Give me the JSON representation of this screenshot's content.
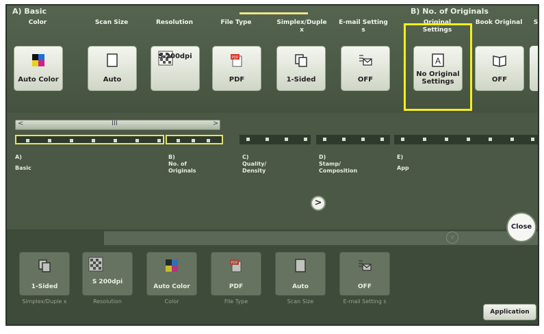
{
  "group_basic": "A)  Basic",
  "group_originals": "B)  No. of Originals",
  "notch_label": "III",
  "headers": [
    "Color",
    "Scan Size",
    "Resolution",
    "File Type",
    "Simplex/Duple x",
    "E-mail Setting s",
    "Original Settings",
    "Book Original",
    "S"
  ],
  "buttons": [
    {
      "value": "Auto Color",
      "icon": "color-icon"
    },
    {
      "value": "Auto",
      "icon": "page-icon"
    },
    {
      "value": "S 200dpi",
      "icon": "resolution-icon"
    },
    {
      "value": "PDF",
      "icon": "pdf-icon"
    },
    {
      "value": "1-Sided",
      "icon": "simplex-icon"
    },
    {
      "value": "OFF",
      "icon": "email-icon"
    },
    {
      "value": "No Original Settings",
      "icon": "original-icon"
    },
    {
      "value": "OFF",
      "icon": "book-icon"
    }
  ],
  "scroll_left": "<",
  "scroll_mid": "III",
  "scroll_right": ">",
  "tabs": [
    {
      "letter": "A)",
      "name": "Basic"
    },
    {
      "letter": "B)",
      "name": "No. of Originals"
    },
    {
      "letter": "C)",
      "name": "Quality/ Density"
    },
    {
      "letter": "D)",
      "name": "Stamp/ Composition"
    },
    {
      "letter": "E)",
      "name": "App"
    }
  ],
  "next_label": ">",
  "close_label": "Close",
  "strip_arrow": "v",
  "shortcuts": [
    {
      "value": "1-Sided",
      "label": "Simplex/Duple x",
      "icon": "simplex-icon"
    },
    {
      "value": "S 200dpi",
      "label": "Resolution",
      "icon": "resolution-icon"
    },
    {
      "value": "Auto Color",
      "label": "Color",
      "icon": "color-icon"
    },
    {
      "value": "PDF",
      "label": "File Type",
      "icon": "pdf-icon"
    },
    {
      "value": "Auto",
      "label": "Scan Size",
      "icon": "page-icon"
    },
    {
      "value": "OFF",
      "label": "E-mail Setting s",
      "icon": "email-icon"
    }
  ],
  "application_label": "Application",
  "highlight_color": "#f4ef1c"
}
